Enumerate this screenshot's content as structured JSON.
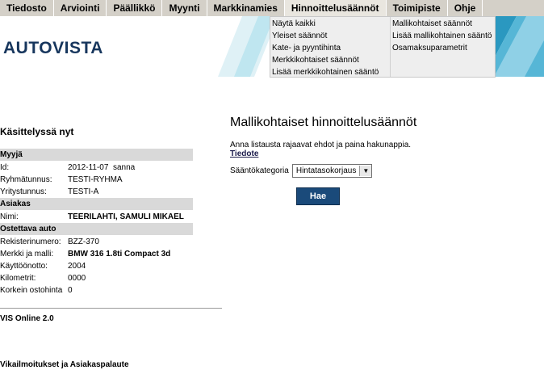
{
  "menubar": {
    "items": [
      {
        "label": "Tiedosto"
      },
      {
        "label": "Arviointi"
      },
      {
        "label": "Päällikkö"
      },
      {
        "label": "Myynti"
      },
      {
        "label": "Markkinamies"
      },
      {
        "label": "Hinnoittelusäännöt"
      },
      {
        "label": "Toimipiste"
      },
      {
        "label": "Ohje"
      }
    ]
  },
  "brand": {
    "logo_text": "AUTOVISTA"
  },
  "dropdown": {
    "left": [
      "Näytä kaikki",
      "Yleiset säännöt",
      "Kate- ja pyyntihinta",
      "Merkkikohtaiset säännöt",
      "Lisää merkkikohtainen sääntö"
    ],
    "right": [
      "Mallikohtaiset säännöt",
      "Lisää mallikohtainen sääntö",
      "Osamaksuparametrit"
    ]
  },
  "sidebar": {
    "title": "Käsittelyssä nyt",
    "myyja": {
      "header": "Myyjä",
      "id_label": "Id:",
      "id_value": "2012-11-07  sanna",
      "group_label": "Ryhmätunnus:",
      "group_value": "TESTI-RYHMA",
      "company_label": "Yritystunnus:",
      "company_value": "TESTI-A"
    },
    "asiakas": {
      "header": "Asiakas",
      "name_label": "Nimi:",
      "name_value": "TEERILAHTI, SAMULI MIKAEL"
    },
    "auto": {
      "header": "Ostettava auto",
      "reg_label": "Rekisterinumero:",
      "reg_value": "BZZ-370",
      "make_label": "Merkki ja malli:",
      "make_value": "BMW 316 1.8ti Compact 3d",
      "year_label": "Käyttöönotto:",
      "year_value": "2004",
      "km_label": "Kilometrit:",
      "km_value": "0000",
      "price_label": "Korkein ostohinta",
      "price_value": "0"
    },
    "vis_online": "VIS Online 2.0",
    "vika": "Vikailmoitukset ja Asiakaspalaute"
  },
  "main": {
    "title": "Mallikohtaiset hinnoittelusäännöt",
    "instructions": "Anna listausta rajaavat ehdot ja paina hakunappia.",
    "link": "Tiedote",
    "category_label": "Sääntökategoria",
    "category_value": "Hintatasokorjaus",
    "search_button": "Hae"
  }
}
